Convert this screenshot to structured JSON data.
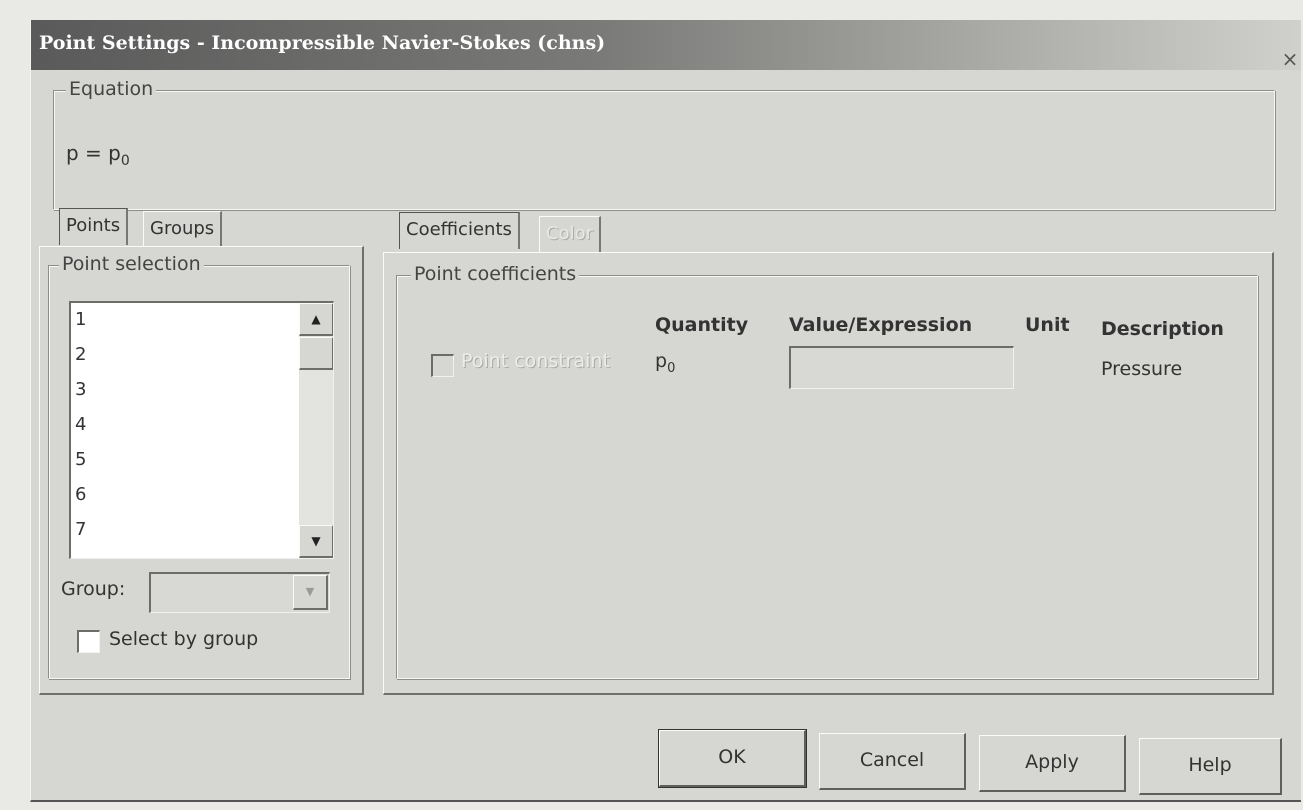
{
  "window": {
    "title": "Point Settings - Incompressible Navier-Stokes (chns)",
    "close_glyph": "×"
  },
  "equation": {
    "group_label": "Equation",
    "formula_main": "p = p",
    "formula_sub": "0"
  },
  "left_tabs": [
    "Points",
    "Groups"
  ],
  "point_selection": {
    "group_label": "Point selection",
    "items": [
      "1",
      "2",
      "3",
      "4",
      "5",
      "6",
      "7"
    ],
    "scroll_up_glyph": "▲",
    "scroll_down_glyph": "▼",
    "group_label_text": "Group:",
    "group_value": "",
    "combo_glyph": "▼",
    "select_by_group_label": "Select by group",
    "select_by_group_checked": false
  },
  "right_tabs": [
    "Coefficients",
    "Color"
  ],
  "point_coefficients": {
    "group_label": "Point coefficients",
    "headers": {
      "quantity": "Quantity",
      "value": "Value/Expression",
      "unit": "Unit",
      "description": "Description"
    },
    "row": {
      "checkbox_label": "Point constraint",
      "checked": false,
      "quantity_main": "p",
      "quantity_sub": "0",
      "value": "",
      "unit": "",
      "description": "Pressure"
    }
  },
  "buttons": {
    "ok": "OK",
    "cancel": "Cancel",
    "apply": "Apply",
    "help": "Help"
  }
}
